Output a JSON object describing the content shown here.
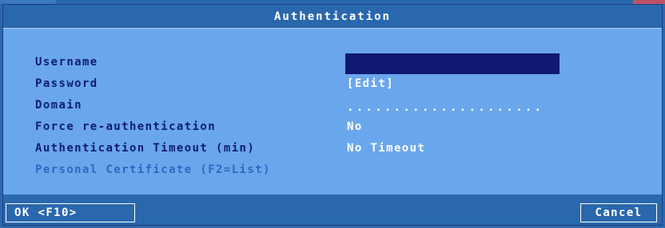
{
  "dialog": {
    "title": "Authentication"
  },
  "fields": {
    "username": {
      "label": "Username",
      "value": ""
    },
    "password": {
      "label": "Password",
      "value": "[Edit]"
    },
    "domain": {
      "label": "Domain",
      "value": "....................."
    },
    "force_reauth": {
      "label": "Force re-authentication",
      "value": "No"
    },
    "timeout": {
      "label": "Authentication Timeout (min)",
      "value": "No Timeout"
    },
    "certificate": {
      "label": "Personal Certificate (F2=List)",
      "value": ""
    }
  },
  "buttons": {
    "ok_label": "OK <F10>",
    "cancel_label": "Cancel"
  },
  "colors": {
    "background": "#2a68ad",
    "dialog_body": "#6aa6ec",
    "label": "#0e1c74",
    "disabled_label": "#2f66c0",
    "value": "#ffffff",
    "input_bg": "#0f1873"
  }
}
